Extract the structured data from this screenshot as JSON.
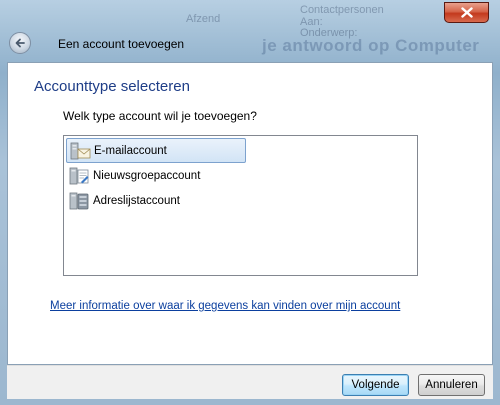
{
  "background": {
    "window_title": "Afzend",
    "window_subtitle_1": "Contactpersonen",
    "window_subtitle_2": "Aan: ",
    "window_subtitle_3": "Onderwerp:",
    "ghost_banner": "je antwoord op Computer"
  },
  "titlebar": {
    "close_icon": "close-icon"
  },
  "header": {
    "back_icon": "back-arrow-icon",
    "title": "Een account toevoegen"
  },
  "main": {
    "instruction": "Accounttype selecteren",
    "question": "Welk type account wil je toevoegen?",
    "account_types": [
      {
        "label": "E-mailaccount",
        "icon": "email-account-icon",
        "selected": true
      },
      {
        "label": "Nieuwsgroepaccount",
        "icon": "newsgroup-account-icon",
        "selected": false
      },
      {
        "label": "Adreslijstaccount",
        "icon": "directory-account-icon",
        "selected": false
      }
    ],
    "info_link": "Meer informatie over waar ik gegevens kan vinden over mijn account"
  },
  "footer": {
    "next_label": "Volgende",
    "cancel_label": "Annuleren"
  },
  "colors": {
    "instruction": "#1e3d87",
    "link": "#0b3f9e",
    "selection": "#d2e4f6"
  }
}
